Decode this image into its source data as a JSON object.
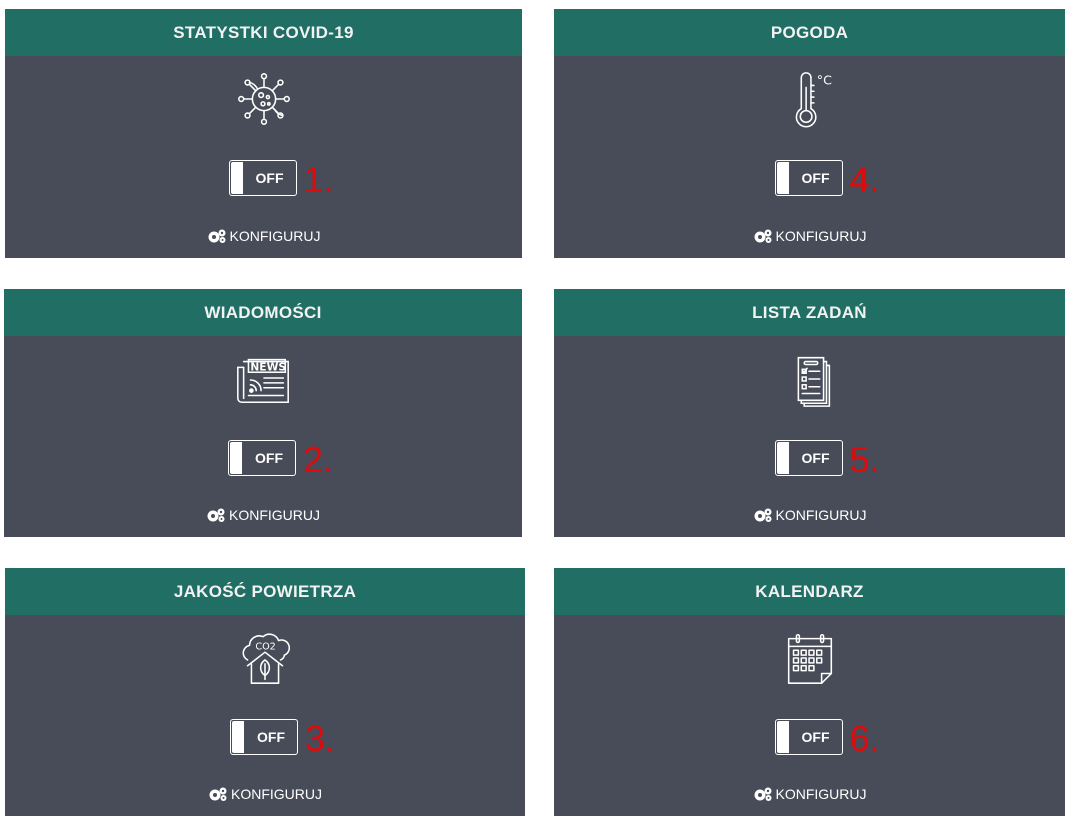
{
  "widgets": [
    {
      "title": "STATYSTKI COVID-19",
      "icon": "virus-icon",
      "toggle": "OFF",
      "annotation": "1.",
      "configure": "KONFIGURUJ"
    },
    {
      "title": "POGODA",
      "icon": "thermometer-icon",
      "toggle": "OFF",
      "annotation": "4.",
      "configure": "KONFIGURUJ"
    },
    {
      "title": "WIADOMOŚCI",
      "icon": "newspaper-icon",
      "toggle": "OFF",
      "annotation": "2.",
      "configure": "KONFIGURUJ"
    },
    {
      "title": "LISTA ZADAŃ",
      "icon": "checklist-icon",
      "toggle": "OFF",
      "annotation": "5.",
      "configure": "KONFIGURUJ"
    },
    {
      "title": "JAKOŚĆ POWIETRZA",
      "icon": "air-quality-icon",
      "toggle": "OFF",
      "annotation": "3.",
      "configure": "KONFIGURUJ"
    },
    {
      "title": "KALENDARZ",
      "icon": "calendar-icon",
      "toggle": "OFF",
      "annotation": "6.",
      "configure": "KONFIGURUJ"
    }
  ],
  "icon_labels": {
    "news": "NEWS",
    "co2": "CO2",
    "celsius": "°C"
  },
  "colors": {
    "header": "#206e64",
    "card": "#474c58",
    "annotation": "#dd0b0b",
    "text": "#ffffff"
  }
}
